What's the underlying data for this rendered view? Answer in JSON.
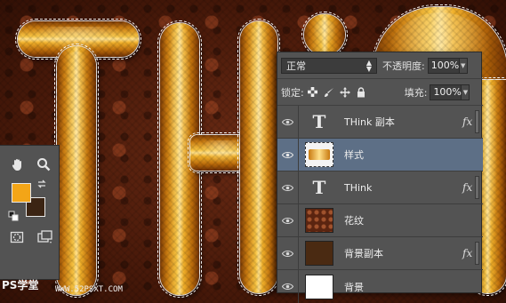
{
  "layers_panel": {
    "blend_mode": "正常",
    "opacity_label": "不透明度:",
    "opacity_value": "100%",
    "lock_label": "锁定:",
    "fill_label": "填充:",
    "fill_value": "100%",
    "layers": [
      {
        "name": "THink 副本",
        "thumb": "text-icon",
        "fx": "fx",
        "selected": false
      },
      {
        "name": "样式",
        "thumb": "style-thumb",
        "fx": "",
        "selected": true
      },
      {
        "name": "THink",
        "thumb": "text-icon",
        "fx": "fx",
        "selected": false
      },
      {
        "name": "花纹",
        "thumb": "pattern-thumb",
        "fx": "",
        "selected": false
      },
      {
        "name": "背景副本",
        "thumb": "brown-thumb",
        "fx": "fx",
        "selected": false
      },
      {
        "name": "背景",
        "thumb": "white-thumb",
        "fx": "",
        "selected": false
      }
    ]
  },
  "tools_panel": {
    "foreground_color": "#f3a517",
    "background_color": "#3b2413"
  },
  "watermark": {
    "left": "PS学堂",
    "right": "WWW.52PSXT.COM"
  },
  "colors": {
    "panel_bg": "#535353",
    "selected_row": "#5d6f86",
    "gold": "#f0b02a"
  }
}
